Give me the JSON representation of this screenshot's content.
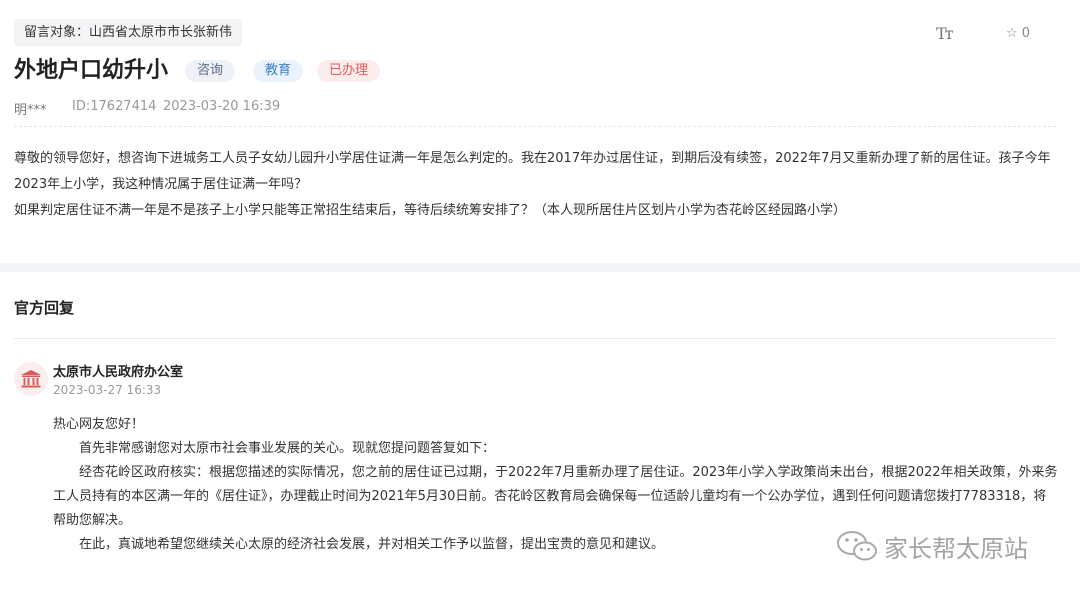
{
  "recipient": "留言对象：山西省太原市市长张新伟",
  "toolbar": {
    "font_size_label": "Tт",
    "favorite_count": "0"
  },
  "title": "外地户口幼升小",
  "tags": [
    "咨询",
    "教育",
    "已办理"
  ],
  "meta": {
    "author": "明***",
    "id": "ID:17627414",
    "date": "2023-03-20 16:39"
  },
  "message": {
    "line1": "尊敬的领导您好，想咨询下进城务工人员子女幼儿园升小学居住证满一年是怎么判定的。我在2017年办过居住证，到期后没有续签，2022年7月又重新办理了新的居住证。孩子今年2023年上小学，我这种情况属于居住证满一年吗？",
    "line2": "如果判定居住证不满一年是不是孩子上小学只能等正常招生结束后，等待后续统筹安排了？（本人现所居住片区划片小学为杏花岭区经园路小学）"
  },
  "reply": {
    "heading": "官方回复",
    "org": "太原市人民政府办公室",
    "date": "2023-03-27 16:33",
    "greeting": "热心网友您好！",
    "para1": "首先非常感谢您对太原市社会事业发展的关心。现就您提问题答复如下：",
    "para2": "经杏花岭区政府核实：根据您描述的实际情况，您之前的居住证已过期，于2022年7月重新办理了居住证。2023年小学入学政策尚未出台，根据2022年相关政策，外来务工人员持有的本区满一年的《居住证》，办理截止时间为2021年5月30日前。杏花岭区教育局会确保每一位适龄儿童均有一个公办学位，遇到任何问题请您拨打7783318，将帮助您解决。",
    "para3": "在此，真诚地希望您继续关心太原的经济社会发展，并对相关工作予以监督，提出宝贵的意见和建议。"
  },
  "watermark": "家长帮太原站",
  "icons": {
    "favorite": "star-outline-icon",
    "avatar": "government-building-icon",
    "watermark": "wechat-icon"
  },
  "colors": {
    "accent_red": "#d85b5b",
    "tag_blue": "#3a7dc6",
    "tag_gray": "#5b6b85"
  }
}
